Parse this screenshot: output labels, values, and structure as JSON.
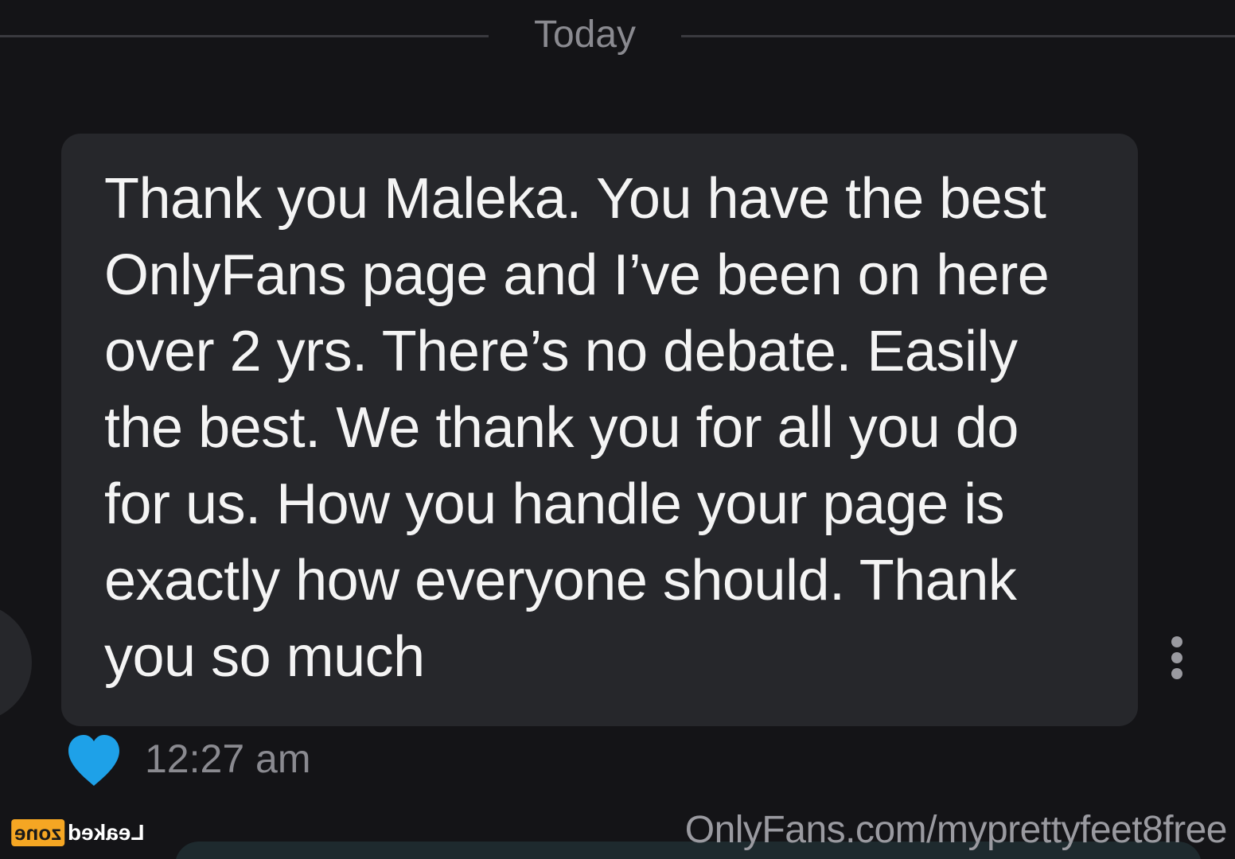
{
  "date_divider": {
    "label": "Today"
  },
  "message": {
    "text": "Thank you Maleka. You have the best\nOnlyFans page and I’ve been on here\nover 2 yrs. There’s no debate. Easily\nthe best. We thank you for all you do\nfor us. How you handle your page is\nexactly how everyone should. Thank\nyou so much",
    "time": "12:27 am",
    "liked": true,
    "like_color": "#1ea1e8",
    "more_icon": "kebab-vertical-icon"
  },
  "watermark": {
    "logo_text_a": "Leaked",
    "logo_text_b": "zone",
    "site": "OnlyFans.com/myprettyfeet8free"
  },
  "colors": {
    "background": "#141417",
    "bubble": "#26272b",
    "text": "#f4f4f4",
    "muted": "#8a8a90",
    "logo_accent": "#f5a623"
  }
}
